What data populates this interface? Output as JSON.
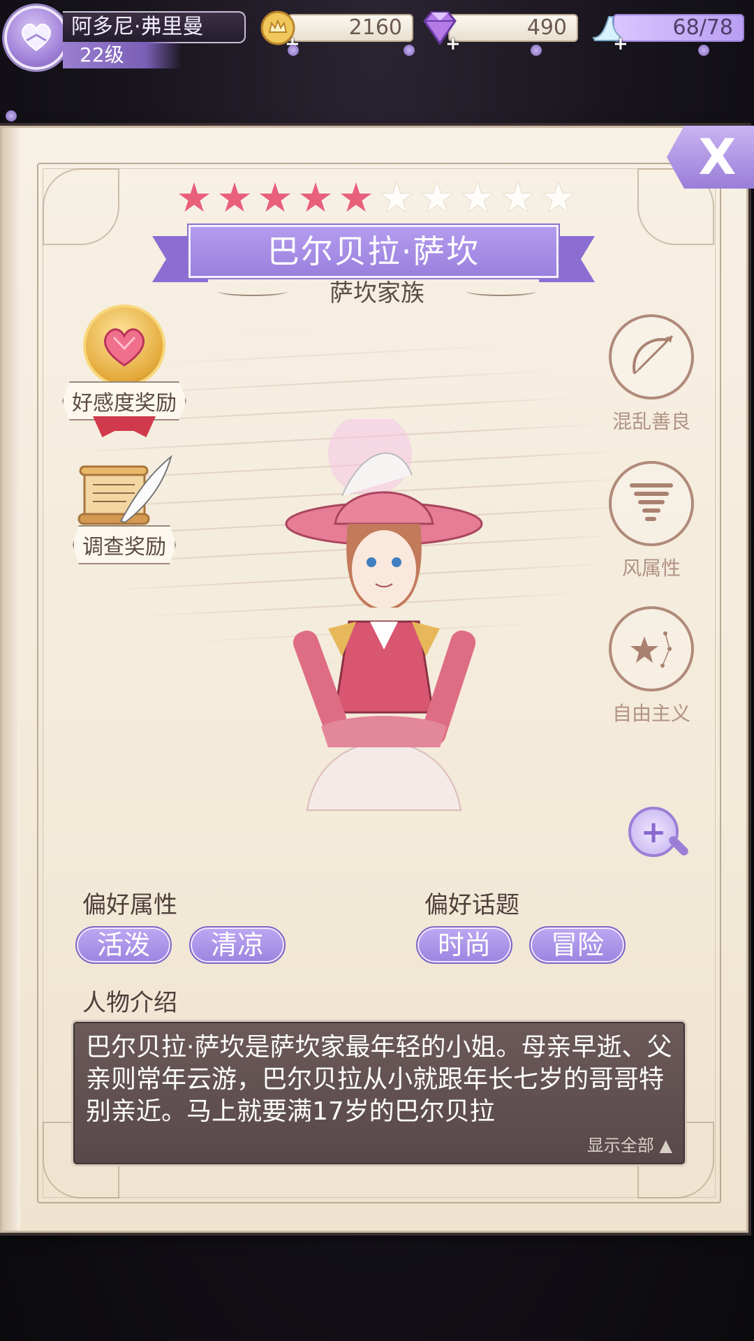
{
  "player": {
    "name": "阿多尼·弗里曼",
    "level": "22级"
  },
  "resources": {
    "gold": "2160",
    "gems": "490",
    "stamina": "68/78"
  },
  "icons": {
    "avatar": "heart-hands-icon",
    "gold": "gold-coin-icon",
    "gems": "diamond-icon",
    "stamina": "glass-slipper-icon",
    "close": "close-icon",
    "zoom": "zoom-in-icon",
    "affection_reward": "heart-medal-icon",
    "investigation_reward": "scroll-quill-icon",
    "alignment": "bow-arrow-icon",
    "element": "tornado-icon",
    "ideology": "constellation-icon"
  },
  "character": {
    "rating_filled": 5,
    "rating_total": 10,
    "name": "巴尔贝拉·萨坎",
    "family": "萨坎家族"
  },
  "rewards": {
    "affection_label": "好感度奖励",
    "investigation_label": "调查奖励"
  },
  "attributes": [
    {
      "label": "混乱善良",
      "icon": "bow-arrow-icon"
    },
    {
      "label": "风属性",
      "icon": "tornado-icon"
    },
    {
      "label": "自由主义",
      "icon": "constellation-icon"
    }
  ],
  "preferences": {
    "attribute_title": "偏好属性",
    "attribute_tags": [
      "活泼",
      "清凉"
    ],
    "topic_title": "偏好话题",
    "topic_tags": [
      "时尚",
      "冒险"
    ]
  },
  "intro": {
    "title": "人物介绍",
    "text": "巴尔贝拉·萨坎是萨坎家最年轻的小姐。母亲早逝、父亲则常年云游，巴尔贝拉从小就跟年长七岁的哥哥特别亲近。马上就要满17岁的巴尔贝拉",
    "show_all": "显示全部 ▲"
  },
  "close_label": "X",
  "colors": {
    "accent_purple": "#9a80dd",
    "star_filled": "#e8607a",
    "intro_bg": "#5f4e4f"
  }
}
